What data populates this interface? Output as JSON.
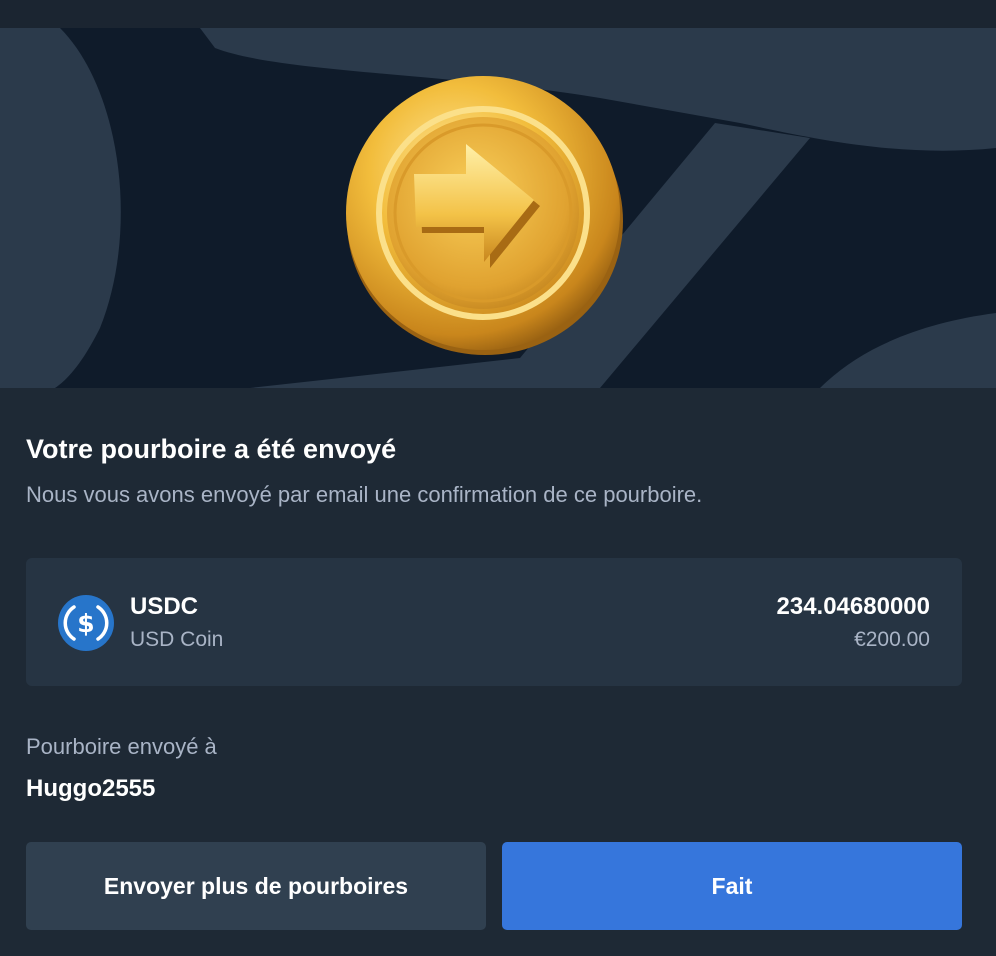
{
  "dialog": {
    "title": "Votre pourboire a été envoyé",
    "subtitle": "Nous vous avons envoyé par email une confirmation de ce pourboire."
  },
  "hero": {
    "icon": "gold-coin-arrow-icon"
  },
  "token": {
    "icon": "usdc-icon",
    "symbol": "USDC",
    "name": "USD Coin",
    "amount": "234.04680000",
    "fiat_value": "€200.00"
  },
  "recipient": {
    "label": "Pourboire envoyé à",
    "username": "Huggo2555"
  },
  "buttons": {
    "secondary_label": "Envoyer plus de pourboires",
    "primary_label": "Fait"
  },
  "colors": {
    "background": "#1e2935",
    "card": "#263443",
    "primary_button": "#3676dc",
    "secondary_button": "#304050",
    "muted_text": "#a9b4c6",
    "usdc_blue": "#2775ca"
  }
}
